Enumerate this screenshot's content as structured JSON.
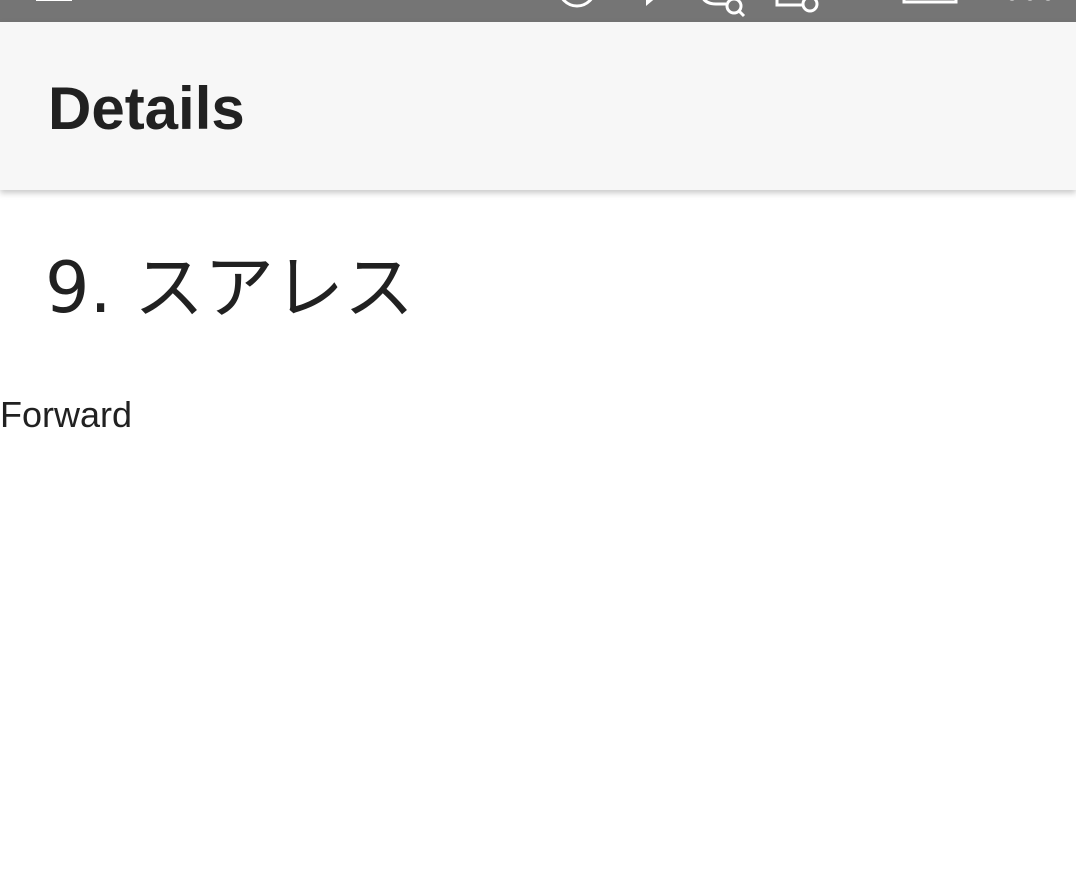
{
  "status_bar": {
    "icons": [
      "menu-icon",
      "clock-icon",
      "play-icon",
      "chat-search-icon",
      "screen-record-icon",
      "battery-icon",
      "signal-dots-icon"
    ]
  },
  "app_bar": {
    "title": "Details"
  },
  "detail": {
    "heading": "9. スアレス",
    "subtitle": "Forward"
  }
}
